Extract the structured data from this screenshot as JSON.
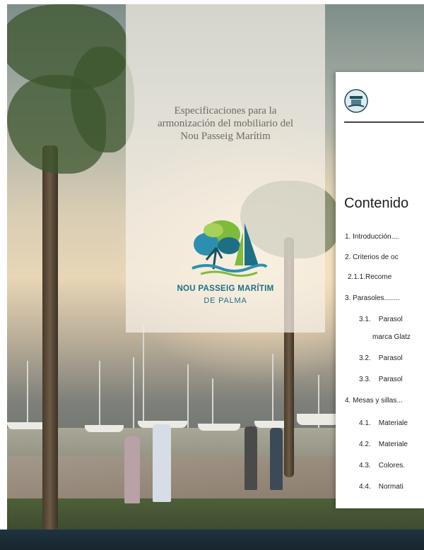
{
  "cover": {
    "title_lines": [
      "Especificaciones para la",
      "armonización del mobiliario del",
      "Nou Passeig Marítim"
    ],
    "brand_line1": "NOU PASSEIG MARÍTIM",
    "brand_line2": "DE PALMA"
  },
  "page2": {
    "toc_title": "Contenido",
    "toc": [
      "1. Introducción....",
      "2. Criterios de oc",
      "2.1.1.Recome",
      "3. Parasoles........",
      "3.1.    Parasol",
      "marca Glatz",
      "3.2.    Parasol",
      "3.3.    Parasol",
      "4. Mesas y sillas...",
      "4.1.    Materiale",
      "4.2.    Materiale",
      "4.3.    Colores.",
      "4.4.    Normati"
    ]
  },
  "colors": {
    "brand_blue": "#1d6f85",
    "logo_green": "#7dbb3c",
    "logo_teal": "#2d8fb0",
    "footer": "#1f3340"
  }
}
